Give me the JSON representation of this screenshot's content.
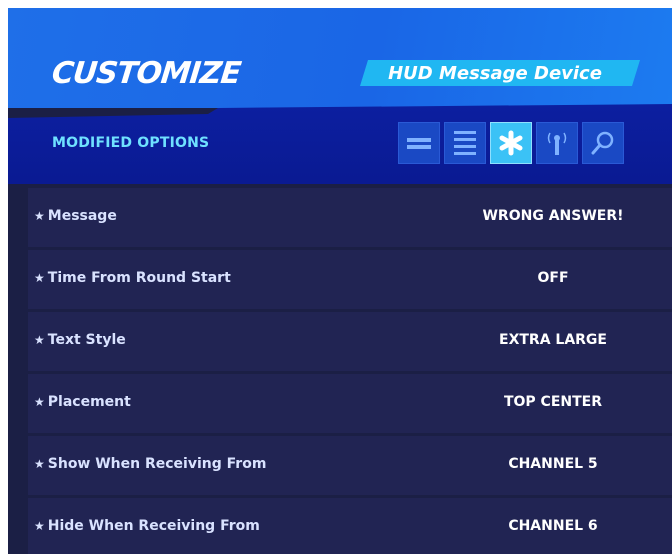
{
  "header": {
    "title": "CUSTOMIZE",
    "device_name": "HUD Message Device",
    "section_label": "MODIFIED OPTIONS"
  },
  "filter_tabs": [
    {
      "icon": "two-lines-icon",
      "active": false
    },
    {
      "icon": "list-lines-icon",
      "active": false
    },
    {
      "icon": "asterisk-icon",
      "active": true
    },
    {
      "icon": "antenna-icon",
      "active": false
    },
    {
      "icon": "search-icon",
      "active": false
    }
  ],
  "options": [
    {
      "label": "Message",
      "value": "WRONG ANSWER!"
    },
    {
      "label": "Time From Round Start",
      "value": "OFF"
    },
    {
      "label": "Text Style",
      "value": "EXTRA LARGE"
    },
    {
      "label": "Placement",
      "value": "TOP CENTER"
    },
    {
      "label": "Show When Receiving From",
      "value": "CHANNEL 5"
    },
    {
      "label": "Hide When Receiving From",
      "value": "CHANNEL 6"
    }
  ],
  "modified_marker": "★",
  "colors": {
    "header_blue": "#1f6fe8",
    "band_navy": "#0c1fa0",
    "accent_cyan": "#20b7f2",
    "row_bg": "#212453",
    "section_text": "#6fe1ff"
  }
}
